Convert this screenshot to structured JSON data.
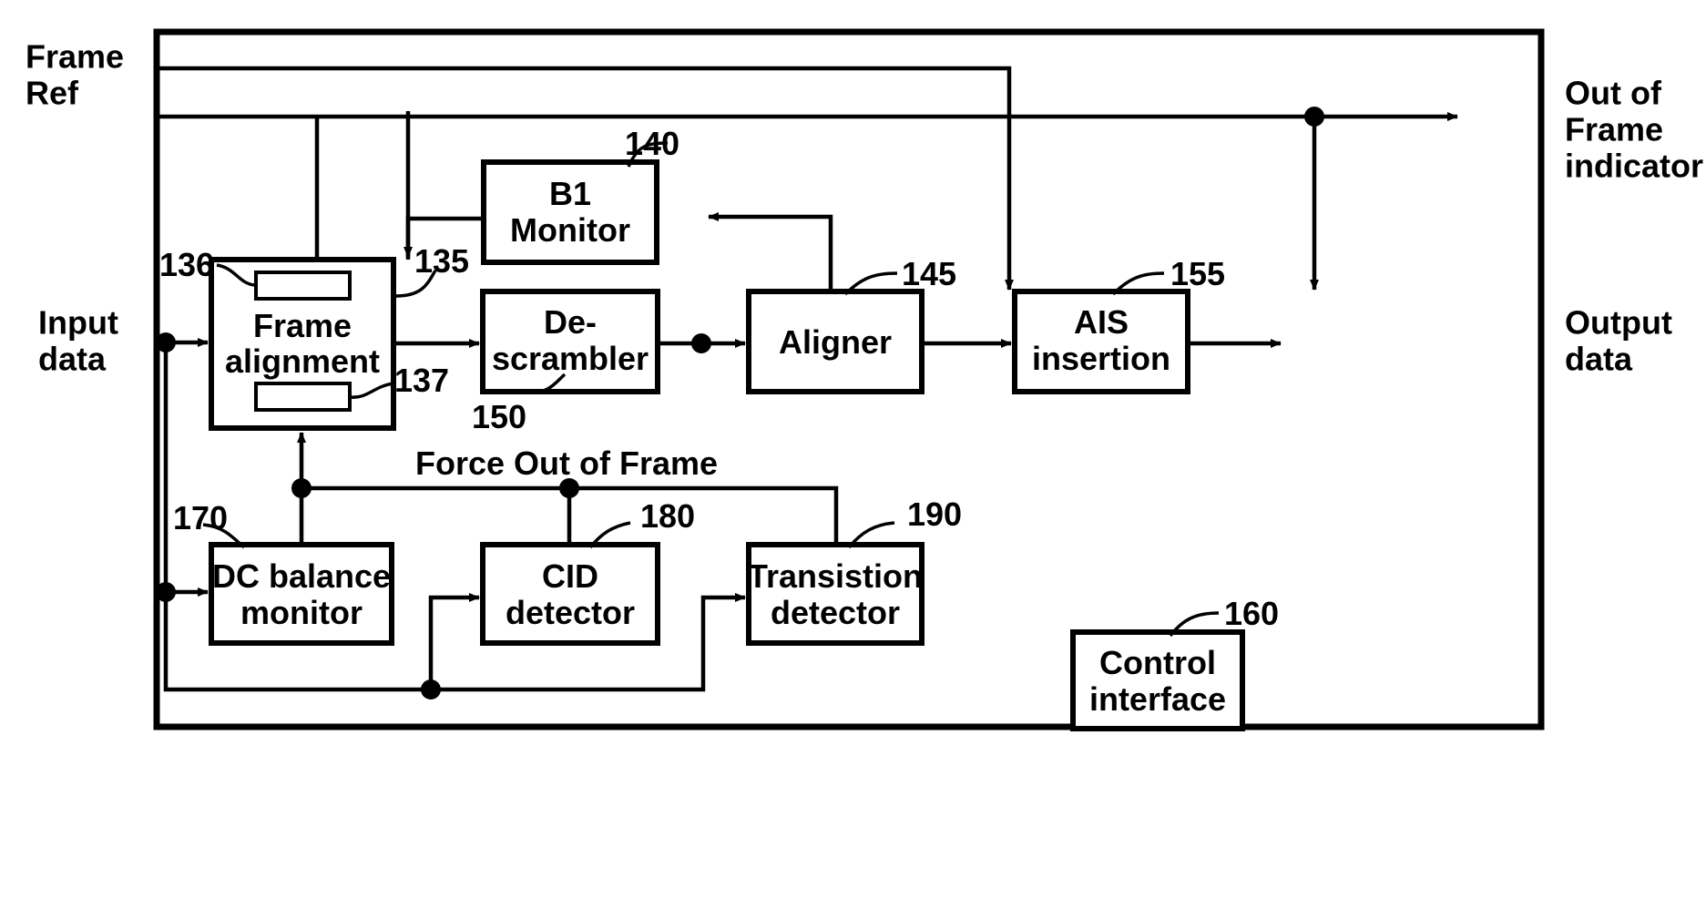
{
  "figure": {
    "type": "patent-block-diagram",
    "background_color": "#ffffff",
    "line_color": "#000000"
  },
  "io_labels": {
    "frame_ref_line1": "Frame",
    "frame_ref_line2": "Ref",
    "input_data_line1": "Input",
    "input_data_line2": "data",
    "out_of_frame_line1": "Out of",
    "out_of_frame_line2": "Frame",
    "out_of_frame_line3": "indicator",
    "output_data_line1": "Output",
    "output_data_line2": "data"
  },
  "signals": {
    "force_out_of_frame": "Force Out of Frame"
  },
  "blocks": [
    {
      "id": "frame-alignment",
      "label_line1": "Frame",
      "label_line2": "alignment",
      "ref": "135",
      "inner_refs": [
        "136",
        "137"
      ]
    },
    {
      "id": "b1-monitor",
      "label_line1": "B1",
      "label_line2": "Monitor",
      "ref": "140"
    },
    {
      "id": "de-scrambler",
      "label_line1": "De-",
      "label_line2": "scrambler",
      "ref": "150"
    },
    {
      "id": "aligner",
      "label_line1": "Aligner",
      "label_line2": "",
      "ref": "145"
    },
    {
      "id": "ais-insertion",
      "label_line1": "AIS",
      "label_line2": "insertion",
      "ref": "155"
    },
    {
      "id": "dc-balance-monitor",
      "label_line1": "DC balance",
      "label_line2": "monitor",
      "ref": "170"
    },
    {
      "id": "cid-detector",
      "label_line1": "CID",
      "label_line2": "detector",
      "ref": "180"
    },
    {
      "id": "transistion-detector",
      "label_line1": "Transistion",
      "label_line2": "detector",
      "ref": "190"
    },
    {
      "id": "control-interface",
      "label_line1": "Control",
      "label_line2": "interface",
      "ref": "160"
    }
  ],
  "reference_numerals": {
    "n135": "135",
    "n136": "136",
    "n137": "137",
    "n140": "140",
    "n145": "145",
    "n150": "150",
    "n155": "155",
    "n160": "160",
    "n170": "170",
    "n180": "180",
    "n190": "190"
  },
  "block_labels": {
    "frame_alignment_1": "Frame",
    "frame_alignment_2": "alignment",
    "b1_monitor_1": "B1",
    "b1_monitor_2": "Monitor",
    "descrambler_1": "De-",
    "descrambler_2": "scrambler",
    "aligner": "Aligner",
    "ais_1": "AIS",
    "ais_2": "insertion",
    "dc_balance_1": "DC balance",
    "dc_balance_2": "monitor",
    "cid_1": "CID",
    "cid_2": "detector",
    "transistion_1": "Transistion",
    "transistion_2": "detector",
    "control_1": "Control",
    "control_2": "interface"
  }
}
